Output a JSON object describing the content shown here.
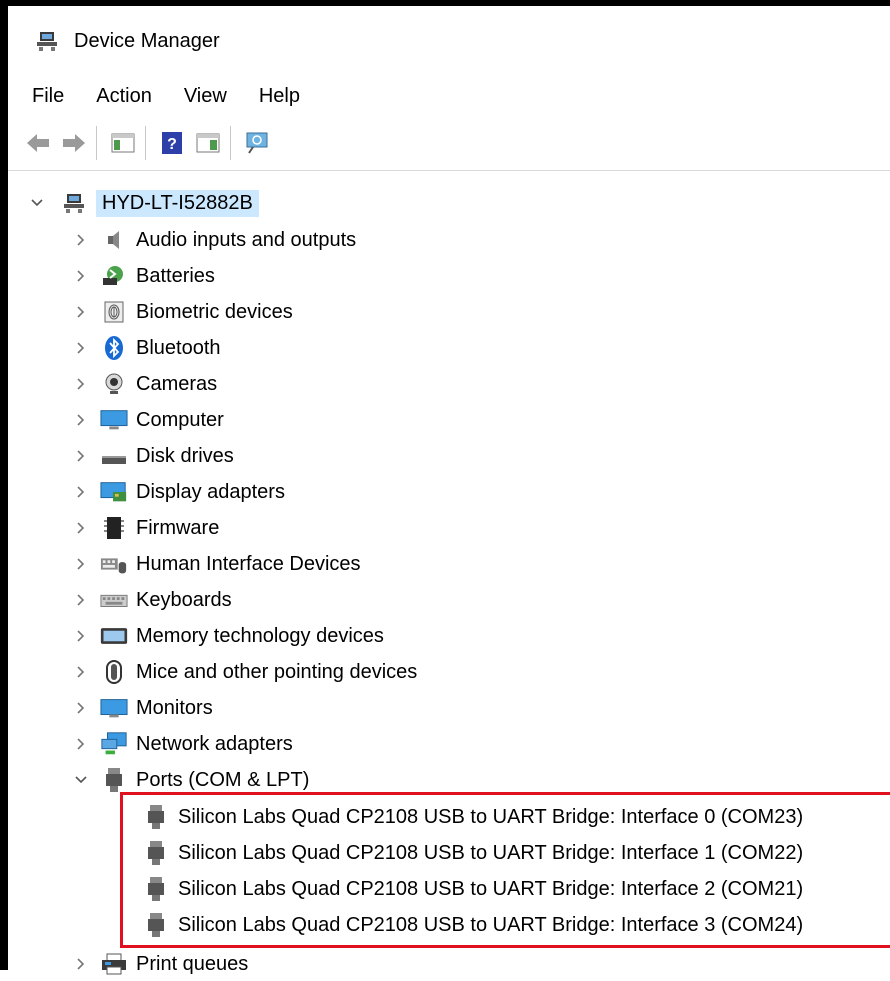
{
  "window": {
    "title": "Device Manager"
  },
  "menu": [
    "File",
    "Action",
    "View",
    "Help"
  ],
  "toolbar": {
    "buttons": [
      "back-icon",
      "forward-icon",
      "show-hide-console-tree-icon",
      "help-icon",
      "show-action-pane-icon",
      "scan-hardware-icon"
    ]
  },
  "tree": {
    "root": "HYD-LT-I52882B",
    "categories": [
      {
        "label": "Audio inputs and outputs",
        "icon": "speaker-icon",
        "expanded": false
      },
      {
        "label": "Batteries",
        "icon": "battery-icon",
        "expanded": false
      },
      {
        "label": "Biometric devices",
        "icon": "fingerprint-icon",
        "expanded": false
      },
      {
        "label": "Bluetooth",
        "icon": "bluetooth-icon",
        "expanded": false
      },
      {
        "label": "Cameras",
        "icon": "camera-icon",
        "expanded": false
      },
      {
        "label": "Computer",
        "icon": "computer-icon",
        "expanded": false
      },
      {
        "label": "Disk drives",
        "icon": "disk-drive-icon",
        "expanded": false
      },
      {
        "label": "Display adapters",
        "icon": "display-adapter-icon",
        "expanded": false
      },
      {
        "label": "Firmware",
        "icon": "firmware-icon",
        "expanded": false
      },
      {
        "label": "Human Interface Devices",
        "icon": "hid-icon",
        "expanded": false
      },
      {
        "label": "Keyboards",
        "icon": "keyboard-icon",
        "expanded": false
      },
      {
        "label": "Memory technology devices",
        "icon": "memory-card-icon",
        "expanded": false
      },
      {
        "label": "Mice and other pointing devices",
        "icon": "mouse-icon",
        "expanded": false
      },
      {
        "label": "Monitors",
        "icon": "monitor-icon",
        "expanded": false
      },
      {
        "label": "Network adapters",
        "icon": "network-icon",
        "expanded": false
      },
      {
        "label": "Ports (COM & LPT)",
        "icon": "port-icon",
        "expanded": true
      },
      {
        "label": "Print queues",
        "icon": "printer-icon",
        "expanded": false
      }
    ],
    "ports_children": [
      "Silicon Labs Quad CP2108 USB to UART Bridge: Interface 0 (COM23)",
      "Silicon Labs Quad CP2108 USB to UART Bridge: Interface 1 (COM22)",
      "Silicon Labs Quad CP2108 USB to UART Bridge: Interface 2 (COM21)",
      "Silicon Labs Quad CP2108 USB to UART Bridge: Interface 3 (COM24)"
    ]
  },
  "colors": {
    "selection": "#cce8ff",
    "highlight_box": "#e0101e"
  }
}
